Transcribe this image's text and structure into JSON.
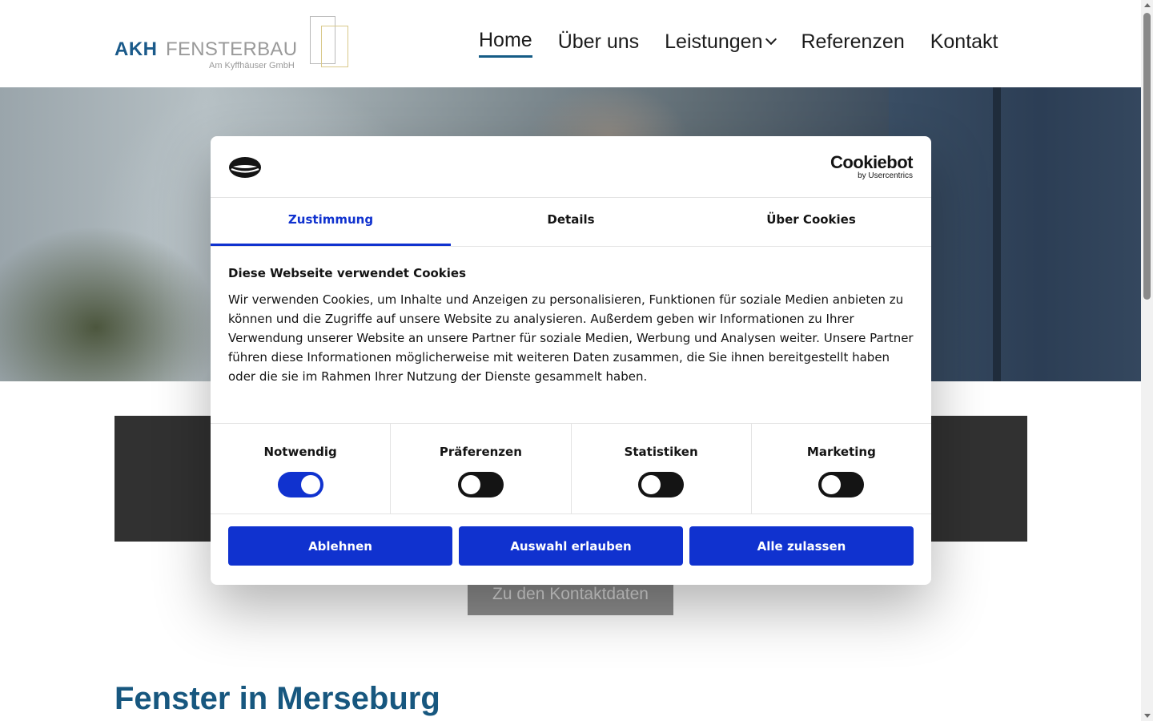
{
  "header": {
    "logo": {
      "brand_bold": "AKH",
      "brand_light": "FENSTERBAU",
      "tagline": "Am Kyffhäuser GmbH"
    },
    "nav": [
      {
        "label": "Home",
        "active": true
      },
      {
        "label": "Über uns"
      },
      {
        "label": "Leistungen",
        "has_dropdown": true
      },
      {
        "label": "Referenzen"
      },
      {
        "label": "Kontakt"
      }
    ]
  },
  "page": {
    "contact_button": "Zu den Kontaktdaten",
    "heading": "Fenster in Merseburg"
  },
  "cookie_dialog": {
    "brand_name": "Cookiebot",
    "brand_sub": "by Usercentrics",
    "tabs": [
      {
        "label": "Zustimmung",
        "active": true
      },
      {
        "label": "Details"
      },
      {
        "label": "Über Cookies"
      }
    ],
    "title": "Diese Webseite verwendet Cookies",
    "text": "Wir verwenden Cookies, um Inhalte und Anzeigen zu personalisieren, Funktionen für soziale Medien anbieten zu können und die Zugriffe auf unsere Website zu analysieren. Außerdem geben wir Informationen zu Ihrer Verwendung unserer Website an unsere Partner für soziale Medien, Werbung und Analysen weiter. Unsere Partner führen diese Informationen möglicherweise mit weiteren Daten zusammen, die Sie ihnen bereitgestellt haben oder die sie im Rahmen Ihrer Nutzung der Dienste gesammelt haben.",
    "categories": [
      {
        "label": "Notwendig",
        "enabled": true
      },
      {
        "label": "Präferenzen",
        "enabled": false
      },
      {
        "label": "Statistiken",
        "enabled": false
      },
      {
        "label": "Marketing",
        "enabled": false
      }
    ],
    "buttons": {
      "decline": "Ablehnen",
      "allow_selection": "Auswahl erlauben",
      "allow_all": "Alle zulassen"
    },
    "accent_color": "#1032cf"
  },
  "colors": {
    "brand_blue": "#17577f",
    "nav_underline": "#155c86"
  }
}
